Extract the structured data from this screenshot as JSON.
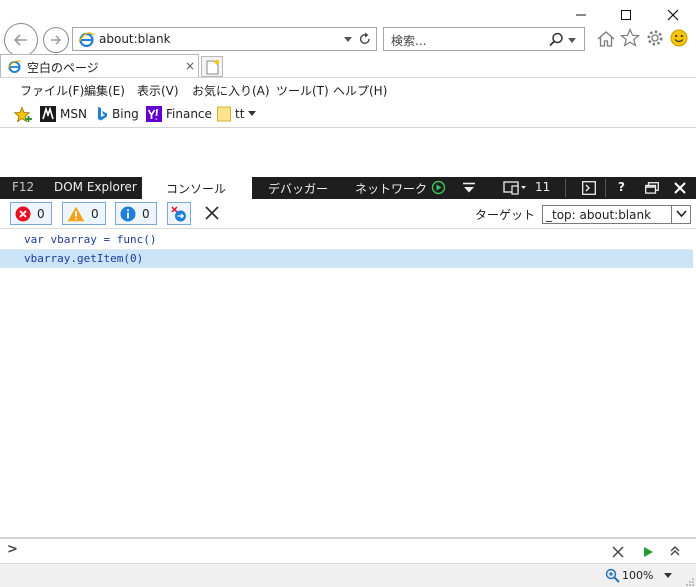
{
  "browser": {
    "address": "about:blank",
    "search_placeholder": "検索...",
    "tab_title": "空白のページ",
    "tab_close": "×"
  },
  "menu": [
    "ファイル(F)",
    "編集(E)",
    "表示(V)",
    "お気に入り(A)",
    "ツール(T)",
    "ヘルプ(H)"
  ],
  "favorites": [
    "MSN",
    "Bing",
    "Finance",
    "tt"
  ],
  "devtools": {
    "f12_label": "F12",
    "tabs": [
      "DOM Explorer",
      "コンソール",
      "デバッガー",
      "ネットワーク"
    ],
    "emulation_count": "11",
    "help": "?",
    "error_count": "0",
    "warning_count": "0",
    "info_count": "0",
    "target_label": "ターゲット",
    "target_value": "_top: about:blank",
    "console_lines": [
      "var vbarray = func()",
      "vbarray.getItem(0)"
    ],
    "prompt": ">"
  },
  "status": {
    "zoom": "100%"
  },
  "colors": {
    "devtools_bar": "#1e1e1e",
    "selection": "#cce4f7",
    "code_text": "#1b3a9e",
    "error": "#e81123",
    "warning": "#f7a11a",
    "info": "#1e7fd8"
  }
}
